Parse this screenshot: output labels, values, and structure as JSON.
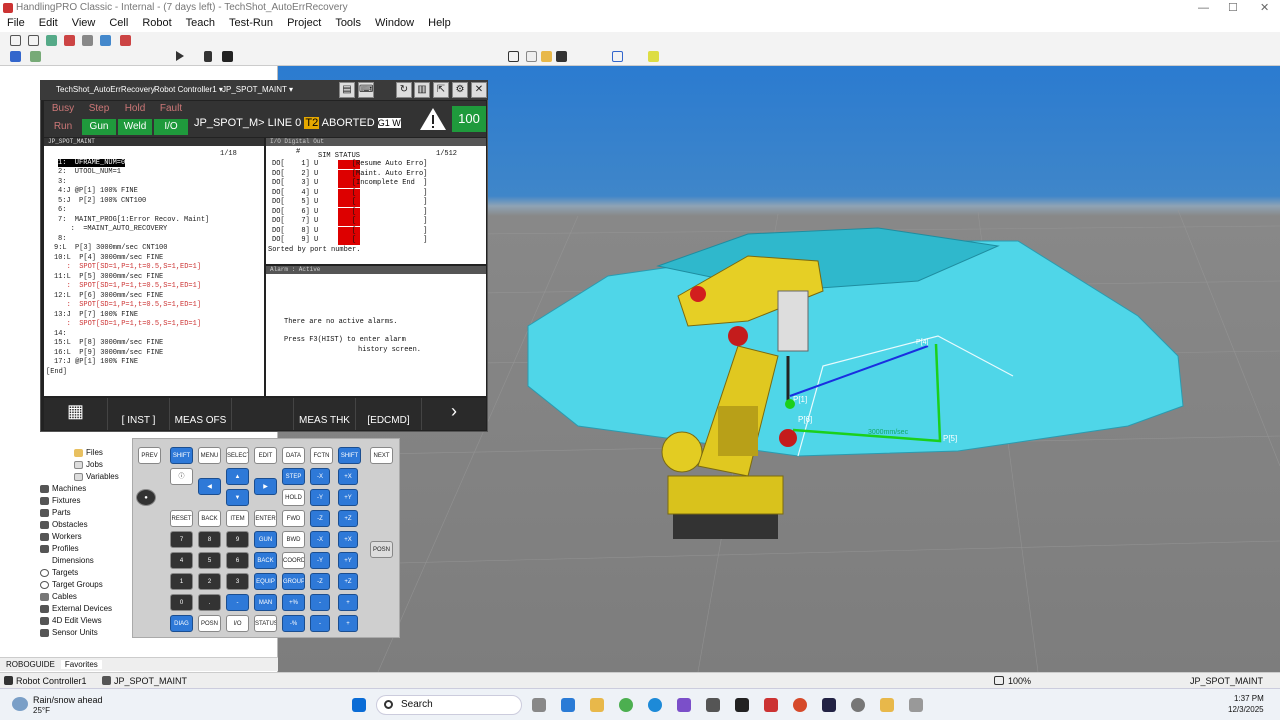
{
  "window": {
    "title": "HandlingPRO Classic - Internal - (7 days left) - TechShot_AutoErrRecovery"
  },
  "menu": [
    "File",
    "Edit",
    "View",
    "Cell",
    "Robot",
    "Teach",
    "Test-Run",
    "Project",
    "Tools",
    "Window",
    "Help"
  ],
  "pendant": {
    "bar_title": "TechShot_AutoErrRecovery",
    "controller": "Robot Controller1 ▾",
    "program_sel": "JP_SPOT_MAINT ▾",
    "status_top": [
      "Busy",
      "Step",
      "Hold",
      "Fault"
    ],
    "status_bottom": [
      "Run",
      "Gun",
      "Weld",
      "I/O"
    ],
    "status_line": "JP_SPOT_M> LINE 0",
    "t2": "T2",
    "aborted": "ABORTED",
    "g1": "G1 W",
    "override": "100",
    "program_header": "JP_SPOT_MAINT",
    "line_count": "1/18",
    "program_lines": [
      "1:  UFRAME_NUM=0",
      "2:  UTOOL_NUM=1",
      "3:",
      "4:J @P[1] 100% FINE",
      "5:J  P[2] 100% CNT100",
      "6:",
      "7:  MAINT_PROG[1:Error Recov. Maint]",
      "   :  =MAINT_AUTO_RECOVERY",
      "8:",
      "9:L  P[3] 3000mm/sec CNT100",
      "10:L  P[4] 3000mm/sec FINE",
      "   :  SPOT[SD=1,P=1,t=0.5,S=1,ED=1]",
      "11:L  P[5] 3000mm/sec FINE",
      "   :  SPOT[SD=1,P=1,t=0.5,S=1,ED=1]",
      "12:L  P[6] 3000mm/sec FINE",
      "   :  SPOT[SD=1,P=1,t=0.5,S=1,ED=1]",
      "13:J  P[7] 100% FINE",
      "   :  SPOT[SD=1,P=1,t=0.5,S=1,ED=1]",
      "14:",
      "15:L  P[8] 3000mm/sec FINE",
      "16:L  P[9] 3000mm/sec FINE",
      "17:J @P[1] 100% FINE",
      "[End]"
    ],
    "io_header": "I/O Digital Out",
    "io_count": "1/512",
    "io_col1": "#",
    "io_col2": "SIM STATUS",
    "io_rows": [
      "DO[    1] U        [Resume Auto Erro]",
      "DO[    2] U        [Maint. Auto Erro]",
      "DO[    3] U        [Incomplete End  ]",
      "DO[    4] U        [                ]",
      "DO[    5] U        [                ]",
      "DO[    6] U        [                ]",
      "DO[    7] U        [                ]",
      "DO[    8] U        [                ]",
      "DO[    9] U        [                ]"
    ],
    "io_footer": "Sorted by port number.",
    "alarm_header": "Alarm : Active",
    "alarm_msg": "There are no active alarms.",
    "alarm_hint1": "Press F3(HIST) to enter alarm",
    "alarm_hint2": "history screen.",
    "fkeys": [
      "[ INST ]",
      "MEAS OFS",
      "",
      "MEAS THK",
      "[EDCMD]"
    ],
    "keys": [
      "PREV",
      "SHIFT",
      "MENU",
      "SELECT",
      "EDIT",
      "DATA",
      "FCTN",
      "SHIFT",
      "NEXT",
      "STEP",
      "HOLD",
      "FWD",
      "BWD",
      "COORD",
      "GROUP",
      "RESET",
      "BACK SPACE",
      "ITEM",
      "ENTER",
      "7",
      "8",
      "9",
      "GUN",
      "4",
      "5",
      "6",
      "BACK UP",
      "1",
      "2",
      "3",
      "EQUIP",
      "0",
      ".",
      "-",
      "MAN FNCT",
      "DIAG HELP",
      "POSN",
      "I/O",
      "STATUS",
      "POSN"
    ]
  },
  "tree": [
    "Files",
    "Jobs",
    "Variables",
    "Machines",
    "Fixtures",
    "Parts",
    "Obstacles",
    "Workers",
    "Profiles",
    "Dimensions",
    "Targets",
    "Target Groups",
    "Cables",
    "External Devices",
    "4D Edit Views",
    "Sensor Units"
  ],
  "left_tabs": [
    "ROBOGUIDE",
    "Favorites"
  ],
  "statusbar": {
    "controller": "Robot Controller1",
    "program": "JP_SPOT_MAINT",
    "zoom": "100%",
    "right": "JP_SPOT_MAINT"
  },
  "scene_labels": [
    "P[1]",
    "P[5]",
    "P[6]",
    "3000mm/sec",
    "P[4]"
  ],
  "taskbar": {
    "weather1": "Rain/snow ahead",
    "weather2": "25°F",
    "search": "Search",
    "time": "1:37 PM",
    "date": "12/3/2025"
  }
}
